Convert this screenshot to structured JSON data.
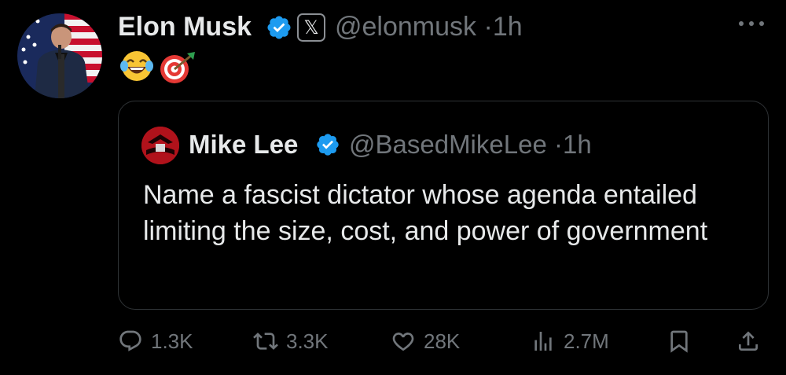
{
  "post": {
    "author_name": "Elon Musk",
    "handle": "@elonmusk",
    "separator": "·",
    "time": "1h",
    "affiliate_badge": "𝕏",
    "emojis": [
      "face-with-tears-of-joy",
      "direct-hit-target"
    ]
  },
  "quoted_post": {
    "author_name": "Mike Lee",
    "handle": "@BasedMikeLee",
    "separator": "·",
    "time": "1h",
    "text": "Name a fascist dictator whose agenda entailed limiting the size, cost, and power of government"
  },
  "actions": {
    "replies": "1.3K",
    "reposts": "3.3K",
    "likes": "28K",
    "views": "2.7M"
  },
  "icons": {
    "verified": "verified-badge-icon",
    "more": "more-icon",
    "reply": "reply-icon",
    "repost": "repost-icon",
    "like": "heart-icon",
    "views": "views-icon",
    "bookmark": "bookmark-icon",
    "share": "share-icon"
  },
  "colors": {
    "background": "#000000",
    "text": "#e7e9ea",
    "secondary": "#71767b",
    "verified": "#1d9bf0",
    "border": "#2f3336"
  }
}
